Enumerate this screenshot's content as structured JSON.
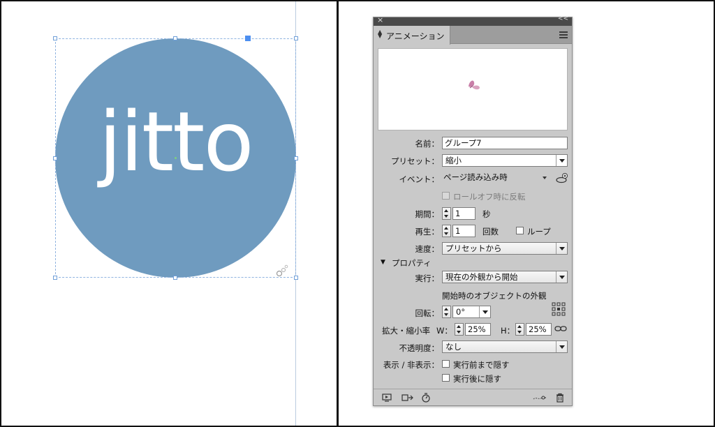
{
  "canvas": {
    "logo_text": "jitto",
    "logo_color": "#6f9bbf",
    "selection_color": "#4d8ff0"
  },
  "panel": {
    "title": "アニメーション",
    "close_icon": "close-icon",
    "menu_icon": "panel-menu-icon",
    "name_label": "名前：",
    "name_value": "グループ7",
    "preset_label": "プリセット：",
    "preset_value": "縮小",
    "event_label": "イベント：",
    "event_value": "ページ読み込み時",
    "rollover_label": "ロールオフ時に反転",
    "duration_label": "期間：",
    "duration_value": "1",
    "duration_unit": "秒",
    "play_label": "再生：",
    "play_value": "1",
    "play_unit": "回数",
    "loop_label": "ループ",
    "speed_label": "速度：",
    "speed_value": "プリセットから",
    "properties_label": "プロパティ",
    "run_label": "実行：",
    "run_value": "現在の外観から開始",
    "start_appearance_label": "開始時のオブジェクトの外観",
    "rotation_label": "回転：",
    "rotation_value": "0°",
    "scale_label": "拡大・縮小率",
    "w_label": "W：",
    "w_value": "25%",
    "h_label": "H：",
    "h_value": "25%",
    "opacity_label": "不透明度：",
    "opacity_value": "なし",
    "visibility_label": "表示 / 非表示：",
    "hide_before_label": "実行前まで隠す",
    "hide_after_label": "実行後に隠す"
  }
}
